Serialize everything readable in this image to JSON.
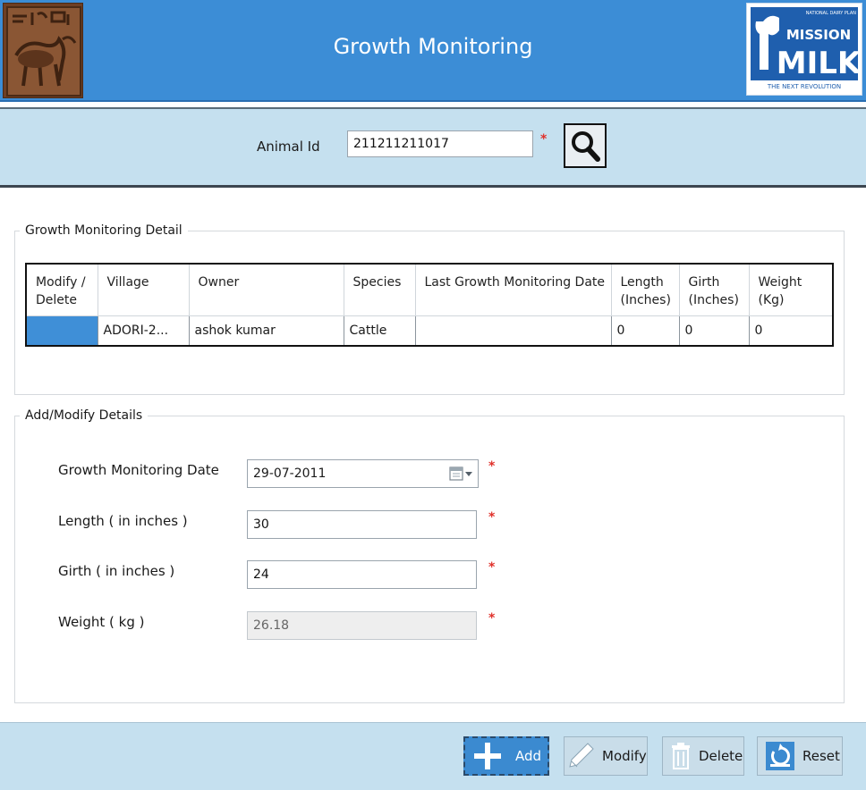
{
  "header": {
    "title": "Growth Monitoring",
    "left_logo_icon": "ancient-seal-logo-icon",
    "right_logo": {
      "top_line": "NATIONAL DAIRY PLAN",
      "line1": "MISSION",
      "line2": "MILK",
      "tagline": "THE NEXT REVOLUTION"
    }
  },
  "search": {
    "animal_id_label": "Animal Id",
    "animal_id_value": "211211211017",
    "required_mark": "*",
    "search_icon": "search-icon"
  },
  "detail_group": {
    "legend": "Growth Monitoring Detail",
    "columns": [
      "Modify / Delete",
      "Village",
      "Owner",
      "Species",
      "Last Growth Monitoring Date",
      "Length (Inches)",
      "Girth (Inches)",
      "Weight (Kg)"
    ],
    "rows": [
      {
        "modify_delete": "",
        "village": "ADORI-2...",
        "owner": "ashok kumar",
        "species": "Cattle",
        "last_date": "",
        "length": "0",
        "girth": "0",
        "weight": "0"
      }
    ]
  },
  "form_group": {
    "legend": "Add/Modify Details",
    "fields": {
      "date_label": "Growth Monitoring Date",
      "date_value": "29-07-2011",
      "length_label": "Length ( in inches )",
      "length_value": "30",
      "girth_label": "Girth ( in inches )",
      "girth_value": "24",
      "weight_label": "Weight ( kg )",
      "weight_value": "26.18"
    },
    "calendar_icon": "calendar-dropdown-icon"
  },
  "actions": {
    "add_label": "Add",
    "modify_label": "Modify",
    "delete_label": "Delete",
    "reset_label": "Reset"
  },
  "colors": {
    "header_blue": "#3c8dd6",
    "band_light_blue": "#c5e0ef",
    "required_red": "#e0312b",
    "selected_cell": "#3f8fd7"
  }
}
